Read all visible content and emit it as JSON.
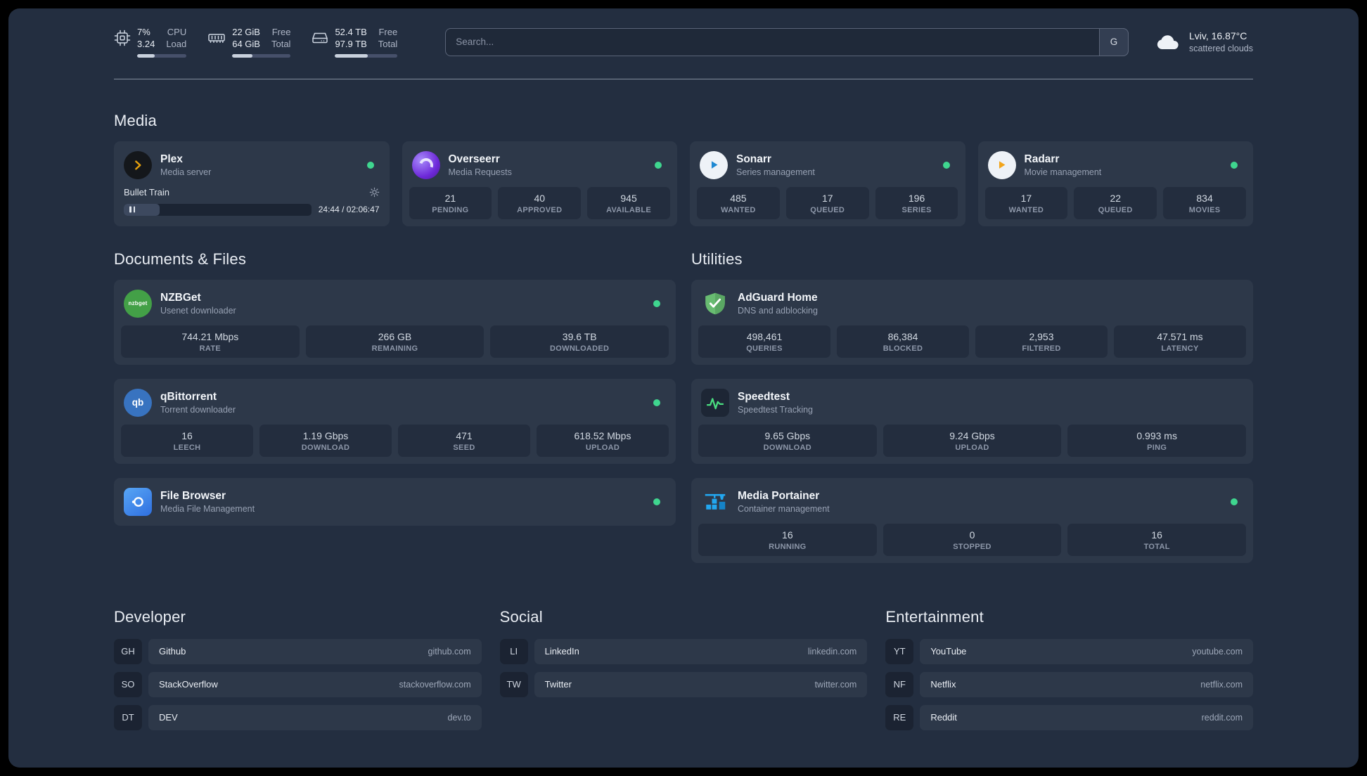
{
  "colors": {
    "status_online": "#3fd68f",
    "accent_green": "#4ade80"
  },
  "icons": {
    "qb_glyph": "qb",
    "nzbget_glyph": "nzbget"
  },
  "topbar": {
    "resources": [
      {
        "icon": "cpu-icon",
        "values": [
          "7%",
          "3.24"
        ],
        "labels": [
          "CPU",
          "Load"
        ],
        "progress_pct": 35
      },
      {
        "icon": "memory-icon",
        "values": [
          "22 GiB",
          "64 GiB"
        ],
        "labels": [
          "Free",
          "Total"
        ],
        "progress_pct": 34
      },
      {
        "icon": "disk-icon",
        "values": [
          "52.4 TB",
          "97.9 TB"
        ],
        "labels": [
          "Free",
          "Total"
        ],
        "progress_pct": 53
      }
    ],
    "search": {
      "placeholder": "Search...",
      "provider_button": "G"
    },
    "weather": {
      "location": "Lviv, 16.87°C",
      "condition": "scattered clouds"
    }
  },
  "media": {
    "title": "Media",
    "services": [
      {
        "name": "Plex",
        "description": "Media server",
        "online": true,
        "player": {
          "title": "Bullet Train",
          "time": "24:44 / 02:06:47",
          "progress_pct": 19
        }
      },
      {
        "name": "Overseerr",
        "description": "Media Requests",
        "online": true,
        "stats": [
          {
            "value": "21",
            "label": "PENDING"
          },
          {
            "value": "40",
            "label": "APPROVED"
          },
          {
            "value": "945",
            "label": "AVAILABLE"
          }
        ]
      },
      {
        "name": "Sonarr",
        "description": "Series management",
        "online": true,
        "stats": [
          {
            "value": "485",
            "label": "WANTED"
          },
          {
            "value": "17",
            "label": "QUEUED"
          },
          {
            "value": "196",
            "label": "SERIES"
          }
        ]
      },
      {
        "name": "Radarr",
        "description": "Movie management",
        "online": true,
        "stats": [
          {
            "value": "17",
            "label": "WANTED"
          },
          {
            "value": "22",
            "label": "QUEUED"
          },
          {
            "value": "834",
            "label": "MOVIES"
          }
        ]
      }
    ]
  },
  "documents": {
    "title": "Documents & Files",
    "services": [
      {
        "name": "NZBGet",
        "description": "Usenet downloader",
        "online": true,
        "stats": [
          {
            "value": "744.21 Mbps",
            "label": "RATE"
          },
          {
            "value": "266 GB",
            "label": "REMAINING"
          },
          {
            "value": "39.6 TB",
            "label": "DOWNLOADED"
          }
        ]
      },
      {
        "name": "qBittorrent",
        "description": "Torrent downloader",
        "online": true,
        "stats": [
          {
            "value": "16",
            "label": "LEECH"
          },
          {
            "value": "1.19 Gbps",
            "label": "DOWNLOAD"
          },
          {
            "value": "471",
            "label": "SEED"
          },
          {
            "value": "618.52 Mbps",
            "label": "UPLOAD"
          }
        ]
      },
      {
        "name": "File Browser",
        "description": "Media File Management",
        "online": true,
        "stats": []
      }
    ]
  },
  "utilities": {
    "title": "Utilities",
    "services": [
      {
        "name": "AdGuard Home",
        "description": "DNS and adblocking",
        "online": false,
        "stats": [
          {
            "value": "498,461",
            "label": "QUERIES"
          },
          {
            "value": "86,384",
            "label": "BLOCKED"
          },
          {
            "value": "2,953",
            "label": "FILTERED"
          },
          {
            "value": "47.571 ms",
            "label": "LATENCY"
          }
        ]
      },
      {
        "name": "Speedtest",
        "description": "Speedtest Tracking",
        "online": false,
        "stats": [
          {
            "value": "9.65 Gbps",
            "label": "DOWNLOAD"
          },
          {
            "value": "9.24 Gbps",
            "label": "UPLOAD"
          },
          {
            "value": "0.993 ms",
            "label": "PING"
          }
        ]
      },
      {
        "name": "Media Portainer",
        "description": "Container management",
        "online": true,
        "stats": [
          {
            "value": "16",
            "label": "RUNNING"
          },
          {
            "value": "0",
            "label": "STOPPED"
          },
          {
            "value": "16",
            "label": "TOTAL"
          }
        ]
      }
    ]
  },
  "bookmarks": [
    {
      "title": "Developer",
      "items": [
        {
          "abbr": "GH",
          "name": "Github",
          "domain": "github.com"
        },
        {
          "abbr": "SO",
          "name": "StackOverflow",
          "domain": "stackoverflow.com"
        },
        {
          "abbr": "DT",
          "name": "DEV",
          "domain": "dev.to"
        }
      ]
    },
    {
      "title": "Social",
      "items": [
        {
          "abbr": "LI",
          "name": "LinkedIn",
          "domain": "linkedin.com"
        },
        {
          "abbr": "TW",
          "name": "Twitter",
          "domain": "twitter.com"
        }
      ]
    },
    {
      "title": "Entertainment",
      "items": [
        {
          "abbr": "YT",
          "name": "YouTube",
          "domain": "youtube.com"
        },
        {
          "abbr": "NF",
          "name": "Netflix",
          "domain": "netflix.com"
        },
        {
          "abbr": "RE",
          "name": "Reddit",
          "domain": "reddit.com"
        }
      ]
    }
  ]
}
